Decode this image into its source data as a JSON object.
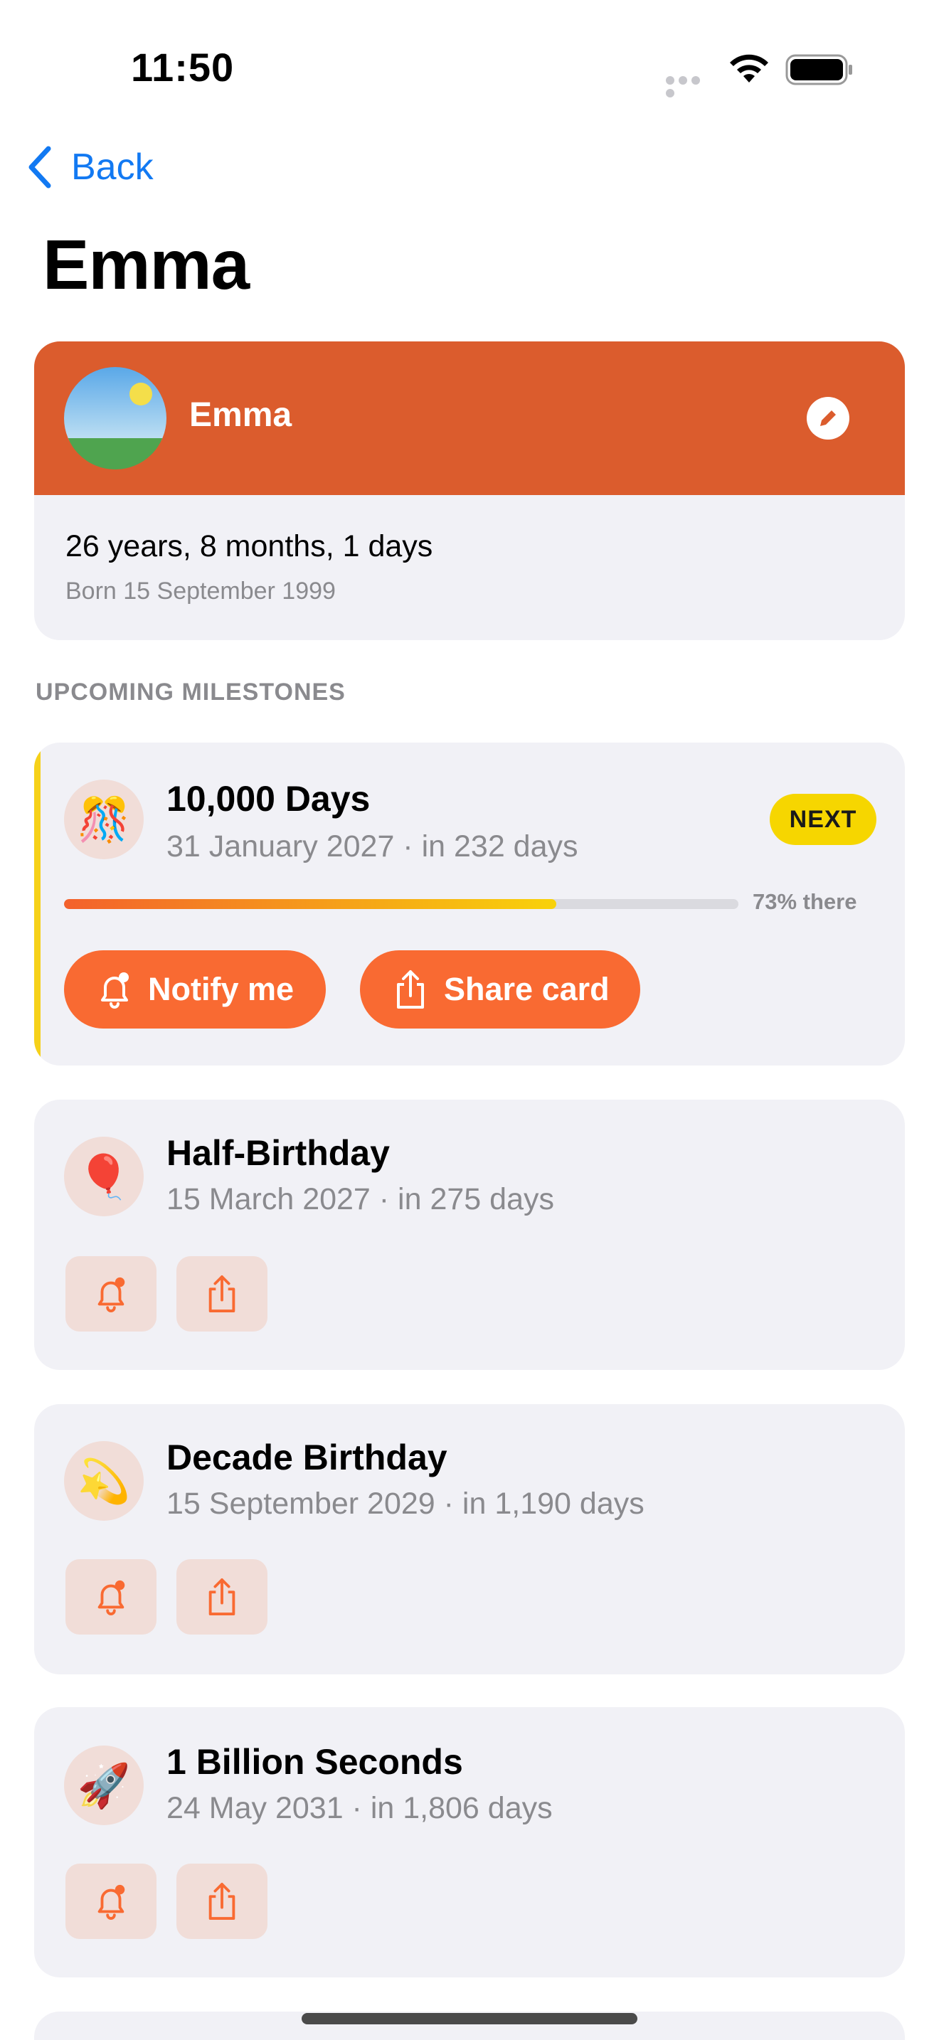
{
  "status_bar": {
    "time": "11:50"
  },
  "nav": {
    "back_label": "Back",
    "title": "Emma"
  },
  "profile": {
    "name": "Emma",
    "age": "26 years, 8 months, 1 days",
    "born": "Born 15 September 1999",
    "header_color": "#db5c2d"
  },
  "section": {
    "upcoming_label": "UPCOMING MILESTONES"
  },
  "milestones": [
    {
      "emoji": "🎊",
      "title": "10,000 Days",
      "subtitle": "31 January 2027 · in 232 days",
      "badge": "NEXT",
      "progress_percent": 73,
      "progress_label": "73% there",
      "notify_label": "Notify me",
      "share_label": "Share card"
    },
    {
      "emoji": "🎈",
      "title": "Half-Birthday",
      "subtitle": "15 March 2027 · in 275 days"
    },
    {
      "emoji": "💫",
      "title": "Decade Birthday",
      "subtitle": "15 September 2029 · in 1,190 days"
    },
    {
      "emoji": "🚀",
      "title": "1 Billion Seconds",
      "subtitle": "24 May 2031 · in 1,806 days"
    }
  ],
  "colors": {
    "accent": "#f96a32",
    "link_blue": "#1279f2",
    "next_badge": "#f6d600",
    "card_bg": "#f1f1f6"
  }
}
